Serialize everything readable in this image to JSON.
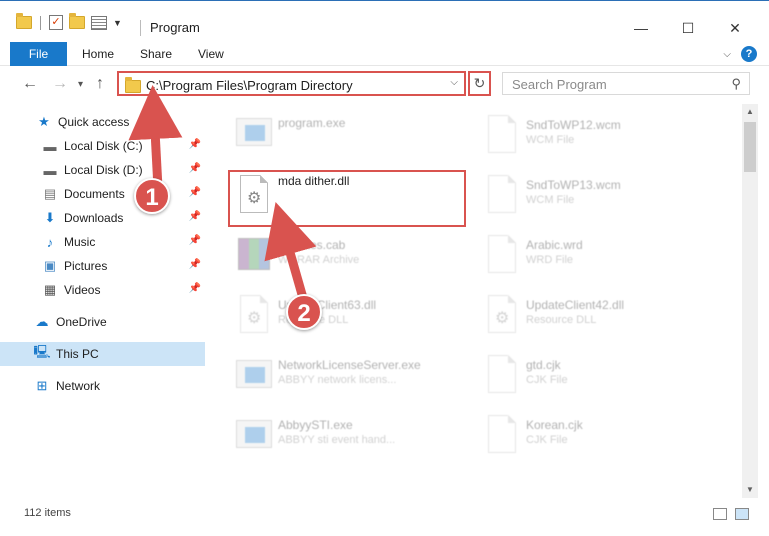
{
  "window": {
    "title": "Program",
    "minimize": "—",
    "maximize": "☐",
    "close": "✕"
  },
  "ribbon": {
    "file": "File",
    "home": "Home",
    "share": "Share",
    "view": "View",
    "help": "?"
  },
  "nav": {
    "back": "←",
    "forward": "→",
    "recent": "▾",
    "up": "↑"
  },
  "address": {
    "path": "C:\\Program Files\\Program Directory",
    "dropdown": "⌵",
    "refresh": "↻"
  },
  "search": {
    "placeholder": "Search Program",
    "icon": "⚲"
  },
  "sidebar": {
    "items": [
      {
        "label": "Quick access"
      },
      {
        "label": "Local Disk (C:)"
      },
      {
        "label": "Local Disk (D:)"
      },
      {
        "label": "Documents"
      },
      {
        "label": "Downloads"
      },
      {
        "label": "Music"
      },
      {
        "label": "Pictures"
      },
      {
        "label": "Videos"
      },
      {
        "label": "OneDrive"
      },
      {
        "label": "This PC"
      },
      {
        "label": "Network"
      }
    ]
  },
  "files": {
    "left": [
      {
        "name": "program.exe",
        "sub": ""
      },
      {
        "name": "mda dither.dll",
        "sub": ""
      },
      {
        "name": "rtificates.cab",
        "sub": "WinRAR Archive"
      },
      {
        "name": "UpdateClient63.dll",
        "sub": "Resource DLL"
      },
      {
        "name": "NetworkLicenseServer.exe",
        "sub": "ABBYY network licens..."
      },
      {
        "name": "AbbyySTI.exe",
        "sub": "ABBYY sti event hand..."
      }
    ],
    "right": [
      {
        "name": "SndToWP12.wcm",
        "sub": "WCM File"
      },
      {
        "name": "SndToWP13.wcm",
        "sub": "WCM File"
      },
      {
        "name": "Arabic.wrd",
        "sub": "WRD File"
      },
      {
        "name": "UpdateClient42.dll",
        "sub": "Resource DLL"
      },
      {
        "name": "gtd.cjk",
        "sub": "CJK File"
      },
      {
        "name": "Korean.cjk",
        "sub": "CJK File"
      }
    ]
  },
  "status": {
    "count": "112 items"
  },
  "callouts": {
    "one": "1",
    "two": "2"
  },
  "colors": {
    "accent": "#1979ca",
    "highlight": "#d9534f",
    "selected": "#cce4f7"
  }
}
